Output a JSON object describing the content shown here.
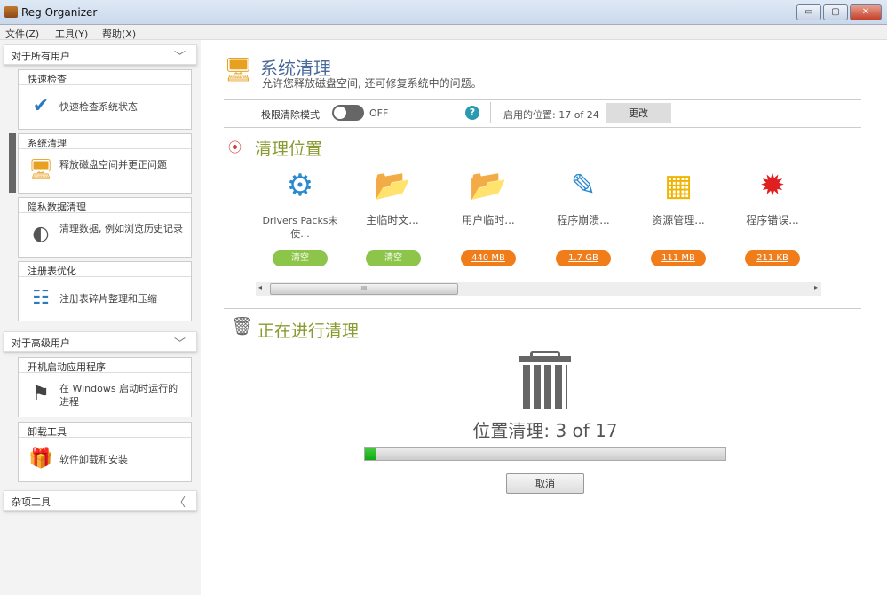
{
  "window": {
    "title": "Reg Organizer",
    "min": "▭",
    "max": "▢",
    "close": "✕"
  },
  "menu": [
    "文件(Z)",
    "工具(Y)",
    "帮助(X)"
  ],
  "sidebar": {
    "group1": "对于所有用户",
    "group2": "对于高级用户",
    "group3": "杂项工具",
    "cards": [
      {
        "title": "快速检查",
        "desc": "快速检查系统状态"
      },
      {
        "title": "系统清理",
        "desc": "释放磁盘空间并更正问题"
      },
      {
        "title": "隐私数据清理",
        "desc": "清理数据, 例如浏览历史记录"
      },
      {
        "title": "注册表优化",
        "desc": "注册表碎片整理和压缩"
      },
      {
        "title": "开机启动应用程序",
        "desc": "在 Windows 启动时运行的进程"
      },
      {
        "title": "卸载工具",
        "desc": "软件卸载和安装"
      }
    ]
  },
  "main": {
    "title": "系统清理",
    "subtitle": "允许您释放磁盘空间, 还可修复系统中的问题。",
    "extreme_label": "极限清除模式",
    "toggle_state": "OFF",
    "enabled_label": "启用的位置: 17 of 24",
    "change_button": "更改",
    "locations_title": "清理位置",
    "items": [
      {
        "label": "Drivers Packs未使...",
        "value": "清空",
        "status": "empty"
      },
      {
        "label": "主临时文...",
        "value": "清空",
        "status": "empty"
      },
      {
        "label": "用户临时...",
        "value": "440 MB",
        "status": "size"
      },
      {
        "label": "程序崩溃...",
        "value": "1.7 GB",
        "status": "size"
      },
      {
        "label": "资源管理...",
        "value": "111 MB",
        "status": "size"
      },
      {
        "label": "程序错误...",
        "value": "211 KB",
        "status": "size"
      }
    ],
    "scroll_grip": "III",
    "progress_title": "正在进行清理",
    "progress_text": "位置清理: 3 of 17",
    "progress_fraction": 0.03,
    "cancel_button": "取消"
  },
  "colors": {
    "green": "#8cc54a",
    "orange": "#f07d1a",
    "title": "#4a6a9a",
    "section": "#8a9a30"
  }
}
